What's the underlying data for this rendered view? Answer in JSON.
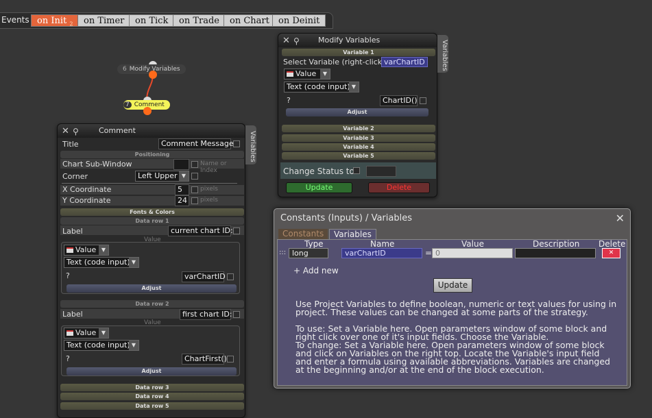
{
  "topbar": {
    "events_label": "Events",
    "tabs": [
      {
        "label": "on Init",
        "badge": "2"
      },
      {
        "label": "on Timer"
      },
      {
        "label": "on Tick"
      },
      {
        "label": "on Trade"
      },
      {
        "label": "on Chart"
      },
      {
        "label": "on Deinit"
      }
    ]
  },
  "nodes": {
    "modify": {
      "num": "6",
      "label": "Modify Variables"
    },
    "comment": {
      "num": "7",
      "label": "Comment"
    }
  },
  "modify_panel": {
    "title": "Modify Variables",
    "side_tab": "Variables",
    "var1_band": "Variable 1",
    "select_label": "Select Variable (right-click)",
    "selected_var": "varChartID",
    "value_drop": "Value",
    "type_drop": "Text (code input)",
    "question": "?",
    "code_value": "ChartID()",
    "adjust": "Adjust",
    "bands": [
      "Variable 2",
      "Variable 3",
      "Variable 4",
      "Variable 5"
    ],
    "change_status": "Change Status to",
    "update": "Update",
    "delete": "Delete"
  },
  "comment_panel": {
    "title": "Comment",
    "side_tab": "Variables",
    "title_label": "Title",
    "title_value": "Comment Message",
    "positioning_band": "Positioning",
    "subwindow_label": "Chart Sub-Window",
    "subwindow_hint": "Name or Index",
    "corner_label": "Corner",
    "corner_value": "Left Upper",
    "x_label": "X Coordinate",
    "x_value": "5",
    "y_label": "Y Coordinate",
    "y_value": "24",
    "pixels_hint": "pixels",
    "fonts_band": "Fonts & Colors",
    "row1_band": "Data row 1",
    "row1_label": "Label",
    "row1_label_value": "current chart ID:",
    "value_band": "Value",
    "value_drop": "Value",
    "type_drop": "Text (code input)",
    "question": "?",
    "row1_code": "varChartID",
    "adjust": "Adjust",
    "row2_band": "Data row 2",
    "row2_label": "Label",
    "row2_label_value": "first chart ID:",
    "row2_code": "ChartFirst()",
    "more_bands": [
      "Data row 3",
      "Data row 4",
      "Data row 5"
    ]
  },
  "constants_panel": {
    "title": "Constants (Inputs) / Variables",
    "tabs": [
      "Constants",
      "Variables"
    ],
    "columns": [
      "Type",
      "Name",
      "Value",
      "Description",
      "Delete"
    ],
    "row": {
      "type": "long",
      "name": "varChartID",
      "eq": "=",
      "value": "0",
      "description": ""
    },
    "add_new": "+ Add new",
    "update": "Update",
    "help": [
      "Use Project Variables to define boolean, numeric or text values for using in project. These values can be changed at some parts of the strategy.",
      "To use: Set a Variable here. Open parameters window of some block and right click over one of it's input fields. Choose the Variable.",
      "To change: Set a Variable here. Open parameters window of some block and click on Variables on the right top. Locate the Variable's input field and enter a formula using available abbreviations. Variables are changed at the beginning and/or at the end of the block execution."
    ]
  },
  "colors": {
    "active_tab": "#e4653b",
    "comment_node": "#f3f35a",
    "node_dot": "#ff6a1a",
    "update_green": "#7f7",
    "delete_red": "#f33"
  }
}
